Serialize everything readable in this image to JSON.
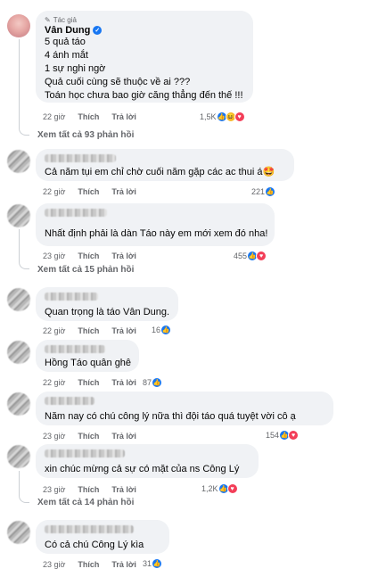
{
  "comments": [
    {
      "author_tag": "Tác giả",
      "name": "Vân Dung",
      "lines": [
        "5 quả táo",
        "4 ánh mắt",
        "1 sự nghi ngờ",
        "Quả cuối cùng sẽ thuộc về ai ???",
        "Toán học chưa bao giờ căng thẳng đến thế !!!"
      ],
      "time": "22 giờ",
      "like_label": "Thích",
      "reply_label": "Trả lời",
      "reaction_count": "1,5K",
      "reactions": [
        "like-icon",
        "laugh-icon",
        "love-icon"
      ],
      "see_replies": "Xem tất cả 93 phản hồi"
    },
    {
      "text": "Cả năm tụi em chỉ chờ cuối năm gặp các ac thui á🤩",
      "time": "22 giờ",
      "like_label": "Thích",
      "reply_label": "Trả lời",
      "reaction_count": "221",
      "reactions": [
        "like-icon"
      ]
    },
    {
      "text": "Nhất định phải là dàn Táo này em mới xem đó nha!",
      "time": "23 giờ",
      "like_label": "Thích",
      "reply_label": "Trả lời",
      "reaction_count": "455",
      "reactions": [
        "like-icon",
        "love-icon"
      ],
      "see_replies": "Xem tất cả 15 phản hồi"
    },
    {
      "text": "Quan trọng là táo Vân Dung.",
      "time": "22 giờ",
      "like_label": "Thích",
      "reply_label": "Trả lời",
      "reaction_count": "16",
      "reactions": [
        "like-icon"
      ]
    },
    {
      "text": "Hồng Táo quân ghê",
      "time": "22 giờ",
      "like_label": "Thích",
      "reply_label": "Trả lời",
      "reaction_count": "87",
      "reactions": [
        "like-icon"
      ]
    },
    {
      "text": "Năm nay có chú công lý nữa thì đội táo quá tuyệt vời cô ạ",
      "time": "23 giờ",
      "like_label": "Thích",
      "reply_label": "Trả lời",
      "reaction_count": "154",
      "reactions": [
        "like-icon",
        "love-icon"
      ]
    },
    {
      "text": "xin chúc mừng cả sự có mặt của ns Công Lý",
      "time": "23 giờ",
      "like_label": "Thích",
      "reply_label": "Trả lời",
      "reaction_count": "1,2K",
      "reactions": [
        "like-icon",
        "love-icon"
      ],
      "see_replies": "Xem tất cả 14 phản hồi"
    },
    {
      "text": "Có cả chú Công Lý kìa",
      "time": "23 giờ",
      "like_label": "Thích",
      "reply_label": "Trả lời",
      "reaction_count": "31",
      "reactions": [
        "like-icon"
      ]
    }
  ],
  "colors": {
    "bubble": "#f0f2f5",
    "like": "#1877f2",
    "love": "#f33e58",
    "laugh": "#f7b928",
    "meta": "#65676b"
  }
}
